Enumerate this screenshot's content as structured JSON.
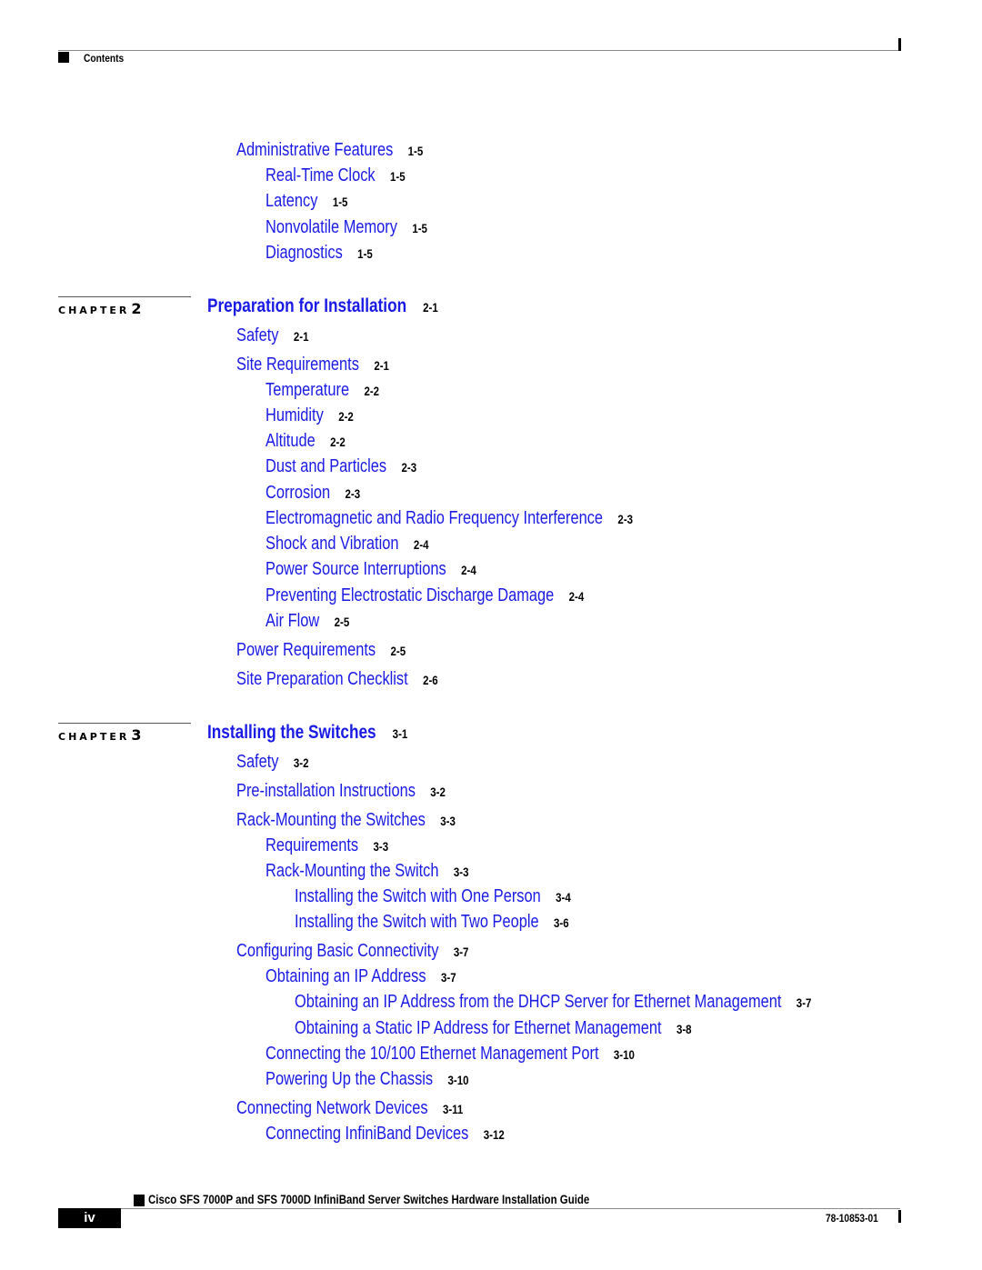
{
  "header": {
    "section_label": "Contents"
  },
  "toc": {
    "pre": [
      {
        "title": "Administrative Features",
        "page": "1-5",
        "level": 1
      },
      {
        "title": "Real-Time Clock",
        "page": "1-5",
        "level": 2
      },
      {
        "title": "Latency",
        "page": "1-5",
        "level": 2
      },
      {
        "title": "Nonvolatile Memory",
        "page": "1-5",
        "level": 2
      },
      {
        "title": "Diagnostics",
        "page": "1-5",
        "level": 2
      }
    ],
    "chapters": [
      {
        "label": "CHAPTER",
        "number": "2",
        "title": "Preparation for Installation",
        "page": "2-1",
        "entries": [
          {
            "title": "Safety",
            "page": "2-1",
            "level": 1
          },
          {
            "title": "Site Requirements",
            "page": "2-1",
            "level": 1
          },
          {
            "title": "Temperature",
            "page": "2-2",
            "level": 2
          },
          {
            "title": "Humidity",
            "page": "2-2",
            "level": 2
          },
          {
            "title": "Altitude",
            "page": "2-2",
            "level": 2
          },
          {
            "title": "Dust and Particles",
            "page": "2-3",
            "level": 2
          },
          {
            "title": "Corrosion",
            "page": "2-3",
            "level": 2
          },
          {
            "title": "Electromagnetic and Radio Frequency Interference",
            "page": "2-3",
            "level": 2
          },
          {
            "title": "Shock and Vibration",
            "page": "2-4",
            "level": 2
          },
          {
            "title": "Power Source Interruptions",
            "page": "2-4",
            "level": 2
          },
          {
            "title": "Preventing Electrostatic Discharge Damage",
            "page": "2-4",
            "level": 2
          },
          {
            "title": "Air Flow",
            "page": "2-5",
            "level": 2
          },
          {
            "title": "Power Requirements",
            "page": "2-5",
            "level": 1
          },
          {
            "title": "Site Preparation Checklist",
            "page": "2-6",
            "level": 1
          }
        ]
      },
      {
        "label": "CHAPTER",
        "number": "3",
        "title": "Installing the Switches",
        "page": "3-1",
        "entries": [
          {
            "title": "Safety",
            "page": "3-2",
            "level": 1
          },
          {
            "title": "Pre-installation Instructions",
            "page": "3-2",
            "level": 1
          },
          {
            "title": "Rack-Mounting the Switches",
            "page": "3-3",
            "level": 1
          },
          {
            "title": "Requirements",
            "page": "3-3",
            "level": 2
          },
          {
            "title": "Rack-Mounting the Switch",
            "page": "3-3",
            "level": 2
          },
          {
            "title": "Installing the Switch with One Person",
            "page": "3-4",
            "level": 3
          },
          {
            "title": "Installing the Switch with Two People",
            "page": "3-6",
            "level": 3
          },
          {
            "title": "Configuring Basic Connectivity",
            "page": "3-7",
            "level": 1
          },
          {
            "title": "Obtaining an IP Address",
            "page": "3-7",
            "level": 2
          },
          {
            "title": "Obtaining an IP Address from the DHCP Server for Ethernet Management",
            "page": "3-7",
            "level": 3
          },
          {
            "title": "Obtaining a Static IP Address for Ethernet Management",
            "page": "3-8",
            "level": 3
          },
          {
            "title": "Connecting the 10/100 Ethernet Management Port",
            "page": "3-10",
            "level": 2
          },
          {
            "title": "Powering Up the Chassis",
            "page": "3-10",
            "level": 2
          },
          {
            "title": "Connecting Network Devices",
            "page": "3-11",
            "level": 1
          },
          {
            "title": "Connecting InfiniBand Devices",
            "page": "3-12",
            "level": 2
          }
        ]
      }
    ]
  },
  "footer": {
    "book_title": "Cisco SFS 7000P and SFS 7000D InfiniBand Server Switches Hardware Installation Guide",
    "page_number": "iv",
    "doc_number": "78-10853-01"
  },
  "colors": {
    "link": "#1a1ae6",
    "page_ref": "#000000"
  }
}
